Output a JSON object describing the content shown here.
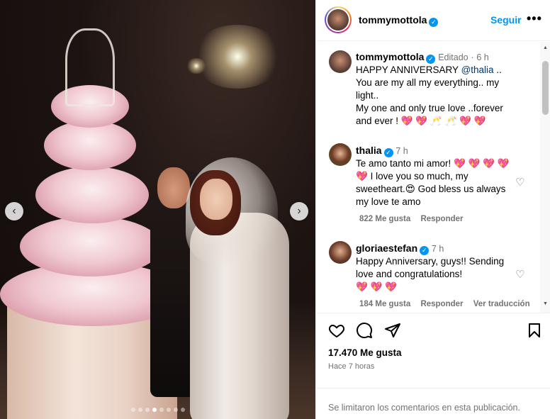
{
  "header": {
    "username": "tommymottola",
    "follow_label": "Seguir",
    "more_label": "•••"
  },
  "caption": {
    "username": "tommymottola",
    "edited": "Editado",
    "separator": "·",
    "time": "6 h",
    "line1_prefix": "HAPPY ANNIVERSARY ",
    "mention": "@thalia",
    "line1_suffix": " ..",
    "line2": "You are my all my everything.. my light..",
    "line3": "My one and only true love ..forever and ever !",
    "emojis": "💖 💖 🥂 🥂 💖 💖"
  },
  "comments": [
    {
      "username": "thalia",
      "time": "7 h",
      "text_start": "Te amo tanto mi amor! ",
      "emojis1": "💖 💖 💖 💖 💖",
      "text_mid": " I love you so much, my sweetheart.",
      "emoji2": "😍",
      "text_end": " God bless us always my love te amo",
      "likes": "822 Me gusta",
      "reply": "Responder"
    },
    {
      "username": "gloriaestefan",
      "time": "7 h",
      "text_start": "Happy Anniversary, guys!! Sending love and congratulations!",
      "emojis1": "💖 💖 💖",
      "likes": "184 Me gusta",
      "reply": "Responder",
      "translate": "Ver traducción"
    }
  ],
  "post": {
    "likes": "17.470 Me gusta",
    "time": "Hace 7 horas",
    "limited_notice": "Se limitaron los comentarios en esta publicación."
  },
  "carousel": {
    "slide_count": 8,
    "active_index": 3
  },
  "icons": {
    "prev": "‹",
    "next": "›",
    "verified": "✓",
    "heart_outline": "♡",
    "scroll_up": "▲",
    "scroll_down": "▼"
  },
  "colors": {
    "link": "#0095f6",
    "verified": "#0095f6",
    "mention": "#00376b",
    "muted": "#737373"
  }
}
